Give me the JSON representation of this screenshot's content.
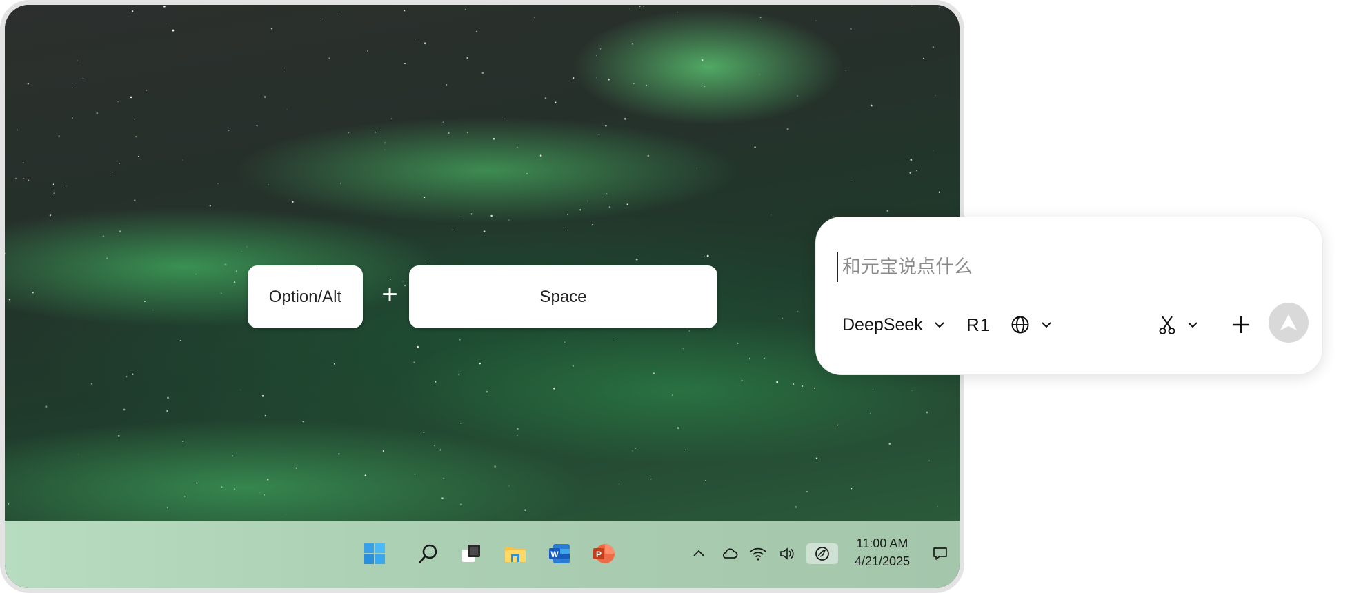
{
  "shortcut": {
    "key1": "Option/Alt",
    "plus": "+",
    "key2": "Space"
  },
  "taskbar": {
    "apps": [
      {
        "name": "start",
        "icon": "windows-logo-icon"
      },
      {
        "name": "search",
        "icon": "search-icon"
      },
      {
        "name": "task-view",
        "icon": "task-view-icon"
      },
      {
        "name": "file-explorer",
        "icon": "folder-icon"
      },
      {
        "name": "word",
        "icon": "word-icon"
      },
      {
        "name": "powerpoint",
        "icon": "powerpoint-icon"
      }
    ],
    "tray": [
      "chevron-up-icon",
      "cloud-icon",
      "wifi-icon",
      "volume-icon",
      "yuanbao-icon"
    ],
    "time": "11:00 AM",
    "date": "4/21/2025",
    "notification_icon": "notification-icon"
  },
  "chat": {
    "placeholder": "和元宝说点什么",
    "model": "DeepSeek",
    "mode": "R1",
    "web_icon": "globe-icon",
    "tool_icon": "scissors-icon",
    "add_icon": "plus-icon",
    "send_icon": "send-icon"
  },
  "colors": {
    "taskbar": "#acd0b4",
    "card": "#ffffff",
    "send_disabled": "#d9d9d9"
  }
}
